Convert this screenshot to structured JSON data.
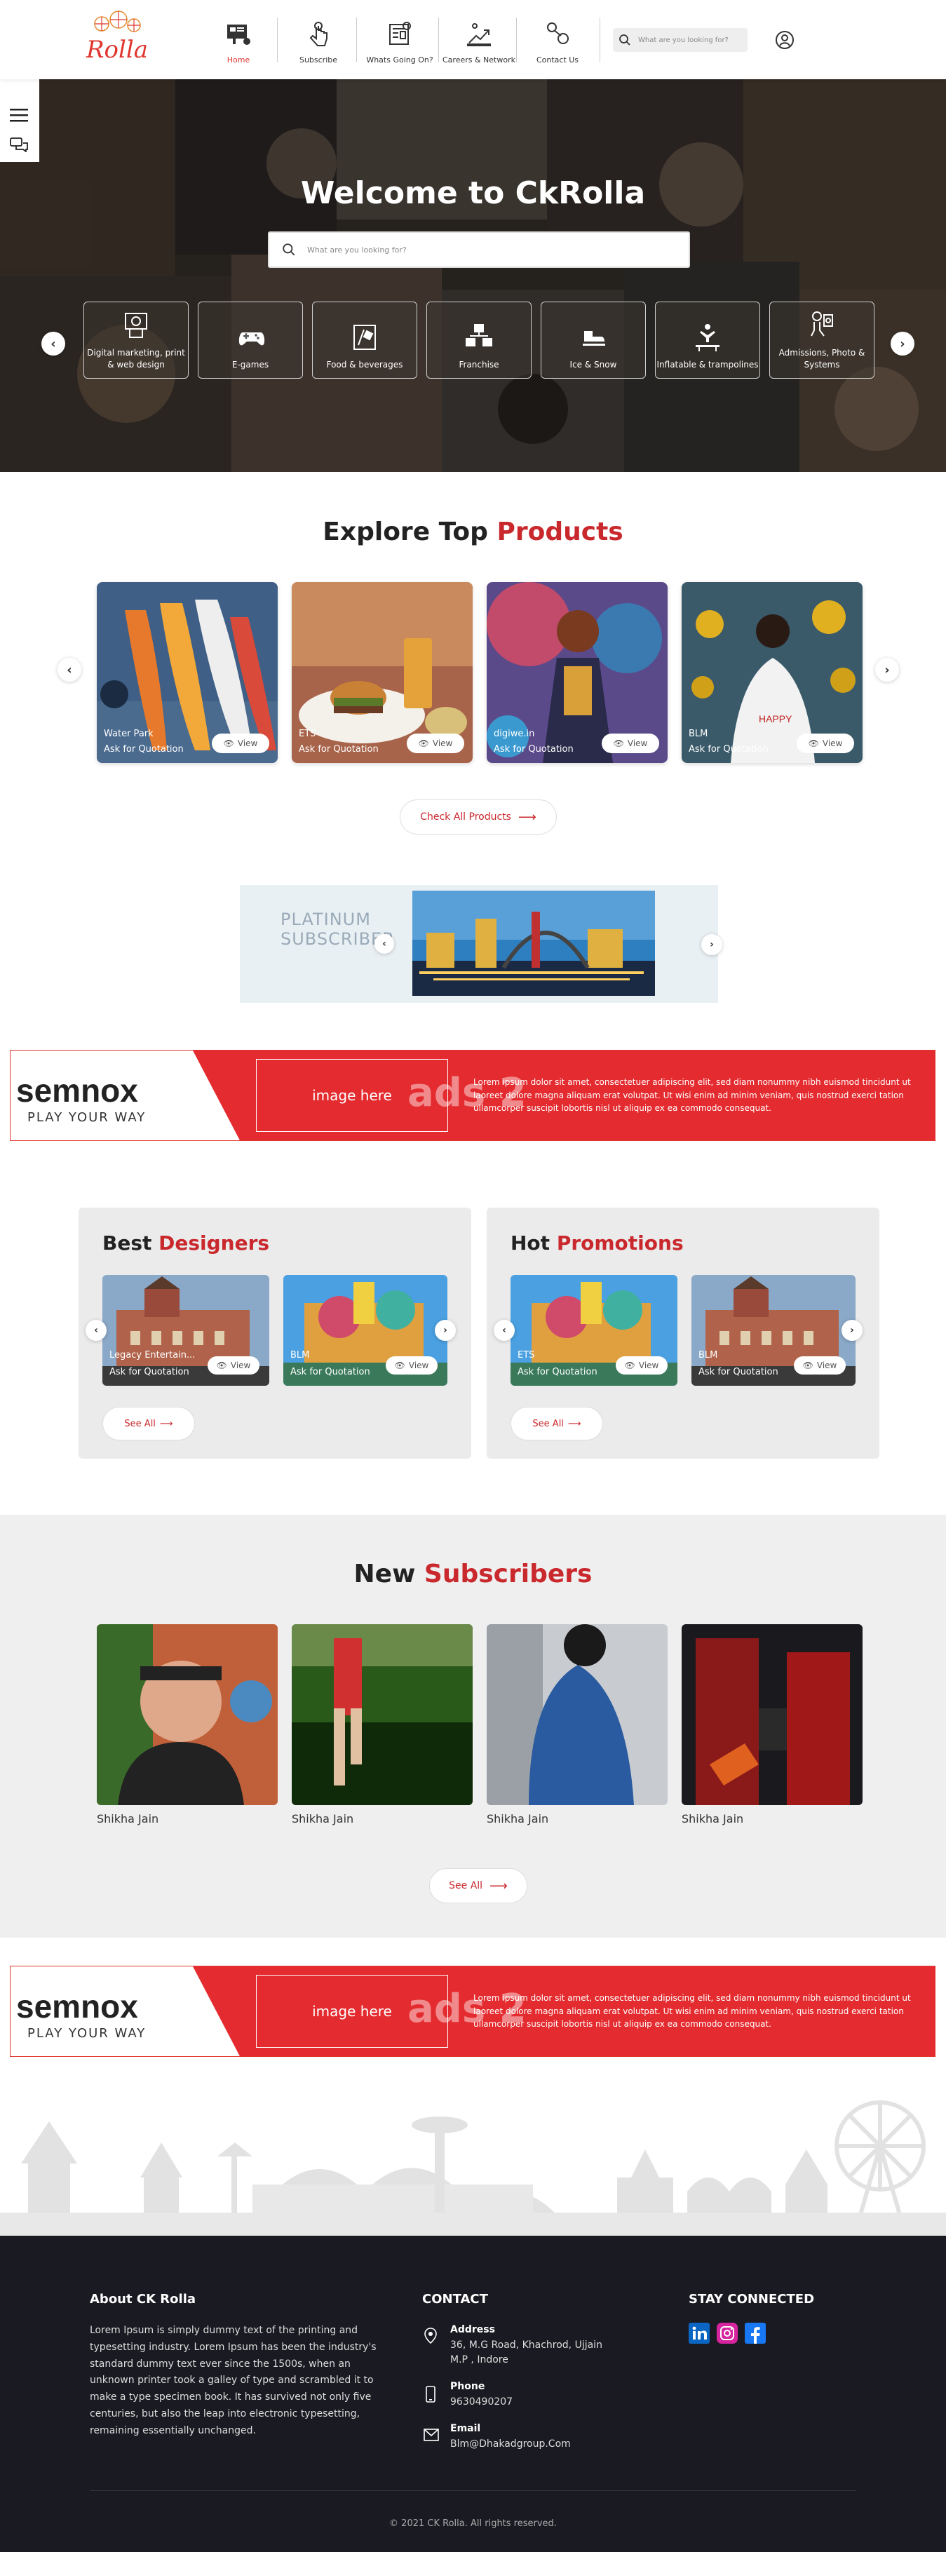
{
  "header": {
    "logo_text": "Rolla",
    "nav": [
      {
        "label": "Home",
        "icon": "dashboard-icon",
        "active": true
      },
      {
        "label": "Subscribe",
        "icon": "hand-tap-icon",
        "active": false
      },
      {
        "label": "Whats Going On?",
        "icon": "newspaper-icon",
        "active": false
      },
      {
        "label": "Careers & Network",
        "icon": "growth-chart-icon",
        "active": false
      },
      {
        "label": "Contact Us",
        "icon": "contact-tap-icon",
        "active": false
      }
    ],
    "search_placeholder": "What are you looking for?",
    "accent": "#e0352e"
  },
  "hero": {
    "title": "Welcome to CkRolla",
    "search_placeholder": "What are you looking for?",
    "categories": [
      {
        "label": "Digital marketing, print & web design",
        "icon": "digital-marketing-icon"
      },
      {
        "label": "E-games",
        "icon": "gamepad-icon"
      },
      {
        "label": "Food & beverages",
        "icon": "food-beverage-icon"
      },
      {
        "label": "Franchise",
        "icon": "franchise-icon"
      },
      {
        "label": "Ice & Snow",
        "icon": "ice-skate-icon"
      },
      {
        "label": "Inflatable & trampolines",
        "icon": "trampoline-icon"
      },
      {
        "label": "Admissions, Photo & Systems",
        "icon": "admission-icon"
      }
    ]
  },
  "products": {
    "title_prefix": "Explore Top",
    "title_highlight": "Products",
    "items": [
      {
        "name": "Water Park",
        "action": "Ask for Quotation",
        "view": "View"
      },
      {
        "name": "ETS",
        "action": "Ask for Quotation",
        "view": "View"
      },
      {
        "name": "digiwe.in",
        "action": "Ask for Quotation",
        "view": "View"
      },
      {
        "name": "BLM",
        "action": "Ask for Quotation",
        "view": "View"
      }
    ],
    "check_all": "Check All Products"
  },
  "platinum": {
    "label": "PLATINUM SUBSCRIBER"
  },
  "ad": {
    "brand": "semnox",
    "tagline": "PLAY YOUR WAY",
    "image_label": "image here",
    "ads_label": "ads 2",
    "text": "Lorem ipsum dolor sit amet, consectetuer adipiscing elit, sed diam nonummy nibh euismod tincidunt ut laoreet dolore magna aliquam erat volutpat. Ut wisi enim ad minim veniam, quis nostrud exerci tation ullamcorper suscipit lobortis nisl ut aliquip ex ea commodo consequat."
  },
  "designers": {
    "title_prefix": "Best",
    "title_highlight": "Designers",
    "items": [
      {
        "name": "Legacy Entertain...",
        "action": "Ask for Quotation",
        "view": "View"
      },
      {
        "name": "BLM",
        "action": "Ask for Quotation",
        "view": "View"
      }
    ],
    "see_all": "See All"
  },
  "promotions": {
    "title_prefix": "Hot",
    "title_highlight": "Promotions",
    "items": [
      {
        "name": "ETS",
        "action": "Ask for Quotation",
        "view": "View"
      },
      {
        "name": "BLM",
        "action": "Ask for Quotation",
        "view": "View"
      }
    ],
    "see_all": "See All"
  },
  "subscribers": {
    "title_prefix": "New",
    "title_highlight": "Subscribers",
    "items": [
      {
        "name": "Shikha Jain"
      },
      {
        "name": "Shikha Jain"
      },
      {
        "name": "Shikha Jain"
      },
      {
        "name": "Shikha Jain"
      }
    ],
    "see_all": "See All"
  },
  "footer": {
    "about_title": "About CK Rolla",
    "about_text": "Lorem Ipsum is simply dummy text of the printing and typesetting industry. Lorem Ipsum has been the industry's standard dummy text ever since the 1500s, when an unknown printer took a galley of type and scrambled it to make a type specimen book. It has survived not only five centuries, but also the leap into electronic typesetting, remaining essentially unchanged.",
    "contact_title": "CONTACT",
    "address_label": "Address",
    "address": "36, M.G Road, Khachrod, Ujjain M.P , Indore",
    "phone_label": "Phone",
    "phone": "9630490207",
    "email_label": "Email",
    "email": "Blm@Dhakadgroup.Com",
    "social_title": "STAY CONNECTED",
    "social": [
      "linkedin-icon",
      "instagram-icon",
      "facebook-icon"
    ],
    "copyright": "© 2021 CK Rolla. All rights reserved."
  }
}
